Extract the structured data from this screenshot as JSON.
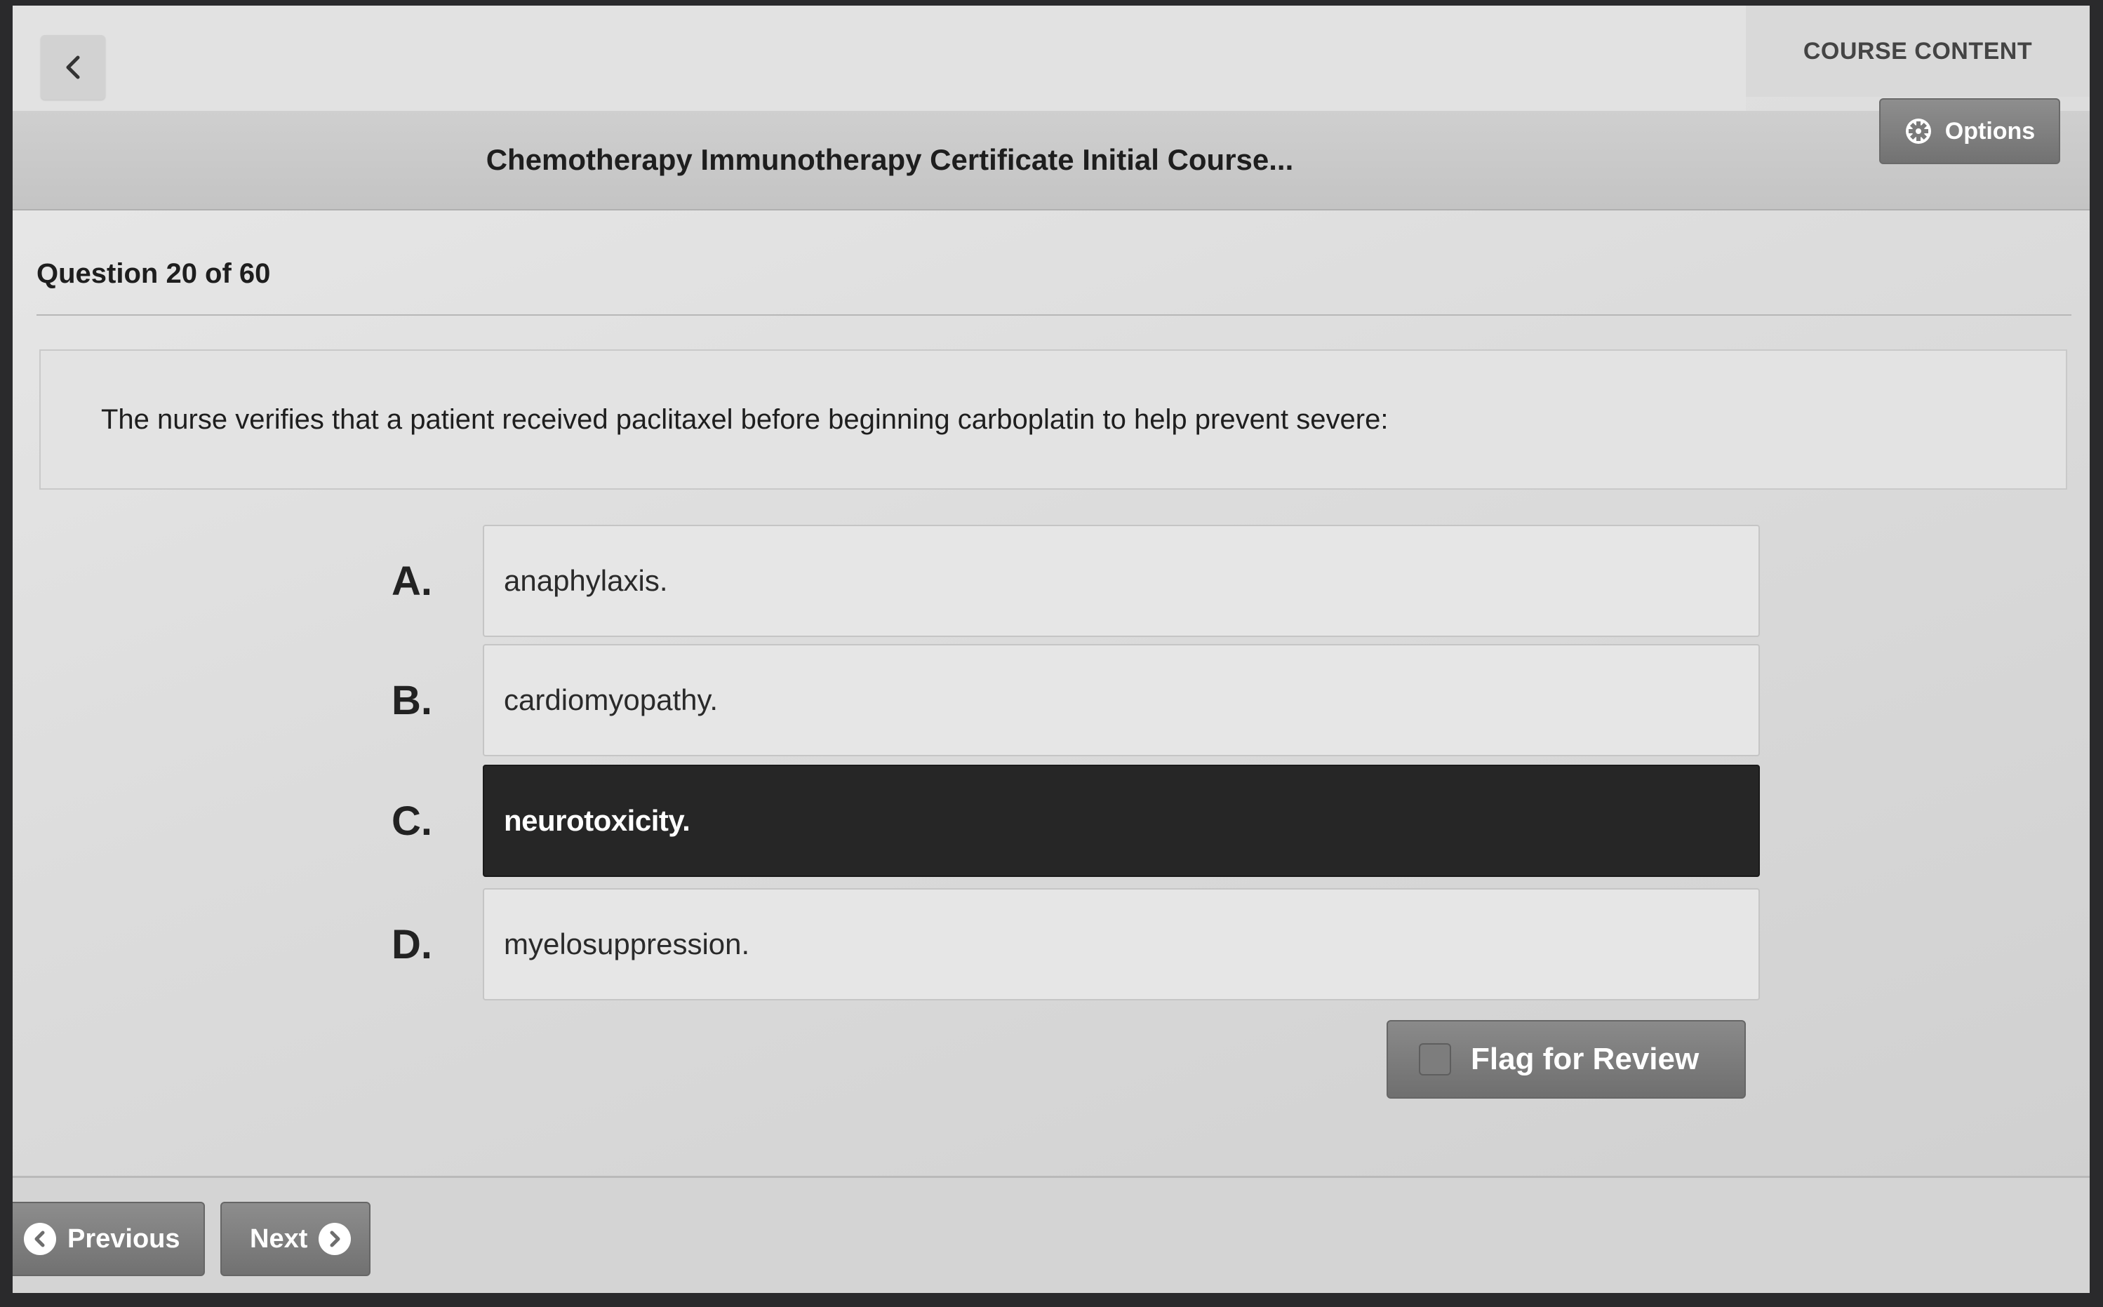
{
  "header": {
    "course_content_label": "COURSE CONTENT",
    "course_title": "Chemotherapy Immunotherapy Certificate Initial Course...",
    "options_label": "Options"
  },
  "question": {
    "counter": "Question 20 of 60",
    "text": "The nurse verifies that a patient received paclitaxel before beginning carboplatin to help prevent severe:"
  },
  "answers": [
    {
      "letter": "A.",
      "text": "anaphylaxis.",
      "selected": false
    },
    {
      "letter": "B.",
      "text": "cardiomyopathy.",
      "selected": false
    },
    {
      "letter": "C.",
      "text": "neurotoxicity.",
      "selected": true
    },
    {
      "letter": "D.",
      "text": "myelosuppression.",
      "selected": false
    }
  ],
  "flag": {
    "label": "Flag for Review",
    "checked": false
  },
  "footer": {
    "previous_label": "Previous",
    "next_label": "Next"
  },
  "colors": {
    "selected_answer_bg": "#262626",
    "button_gray": "#7a7a7a"
  }
}
